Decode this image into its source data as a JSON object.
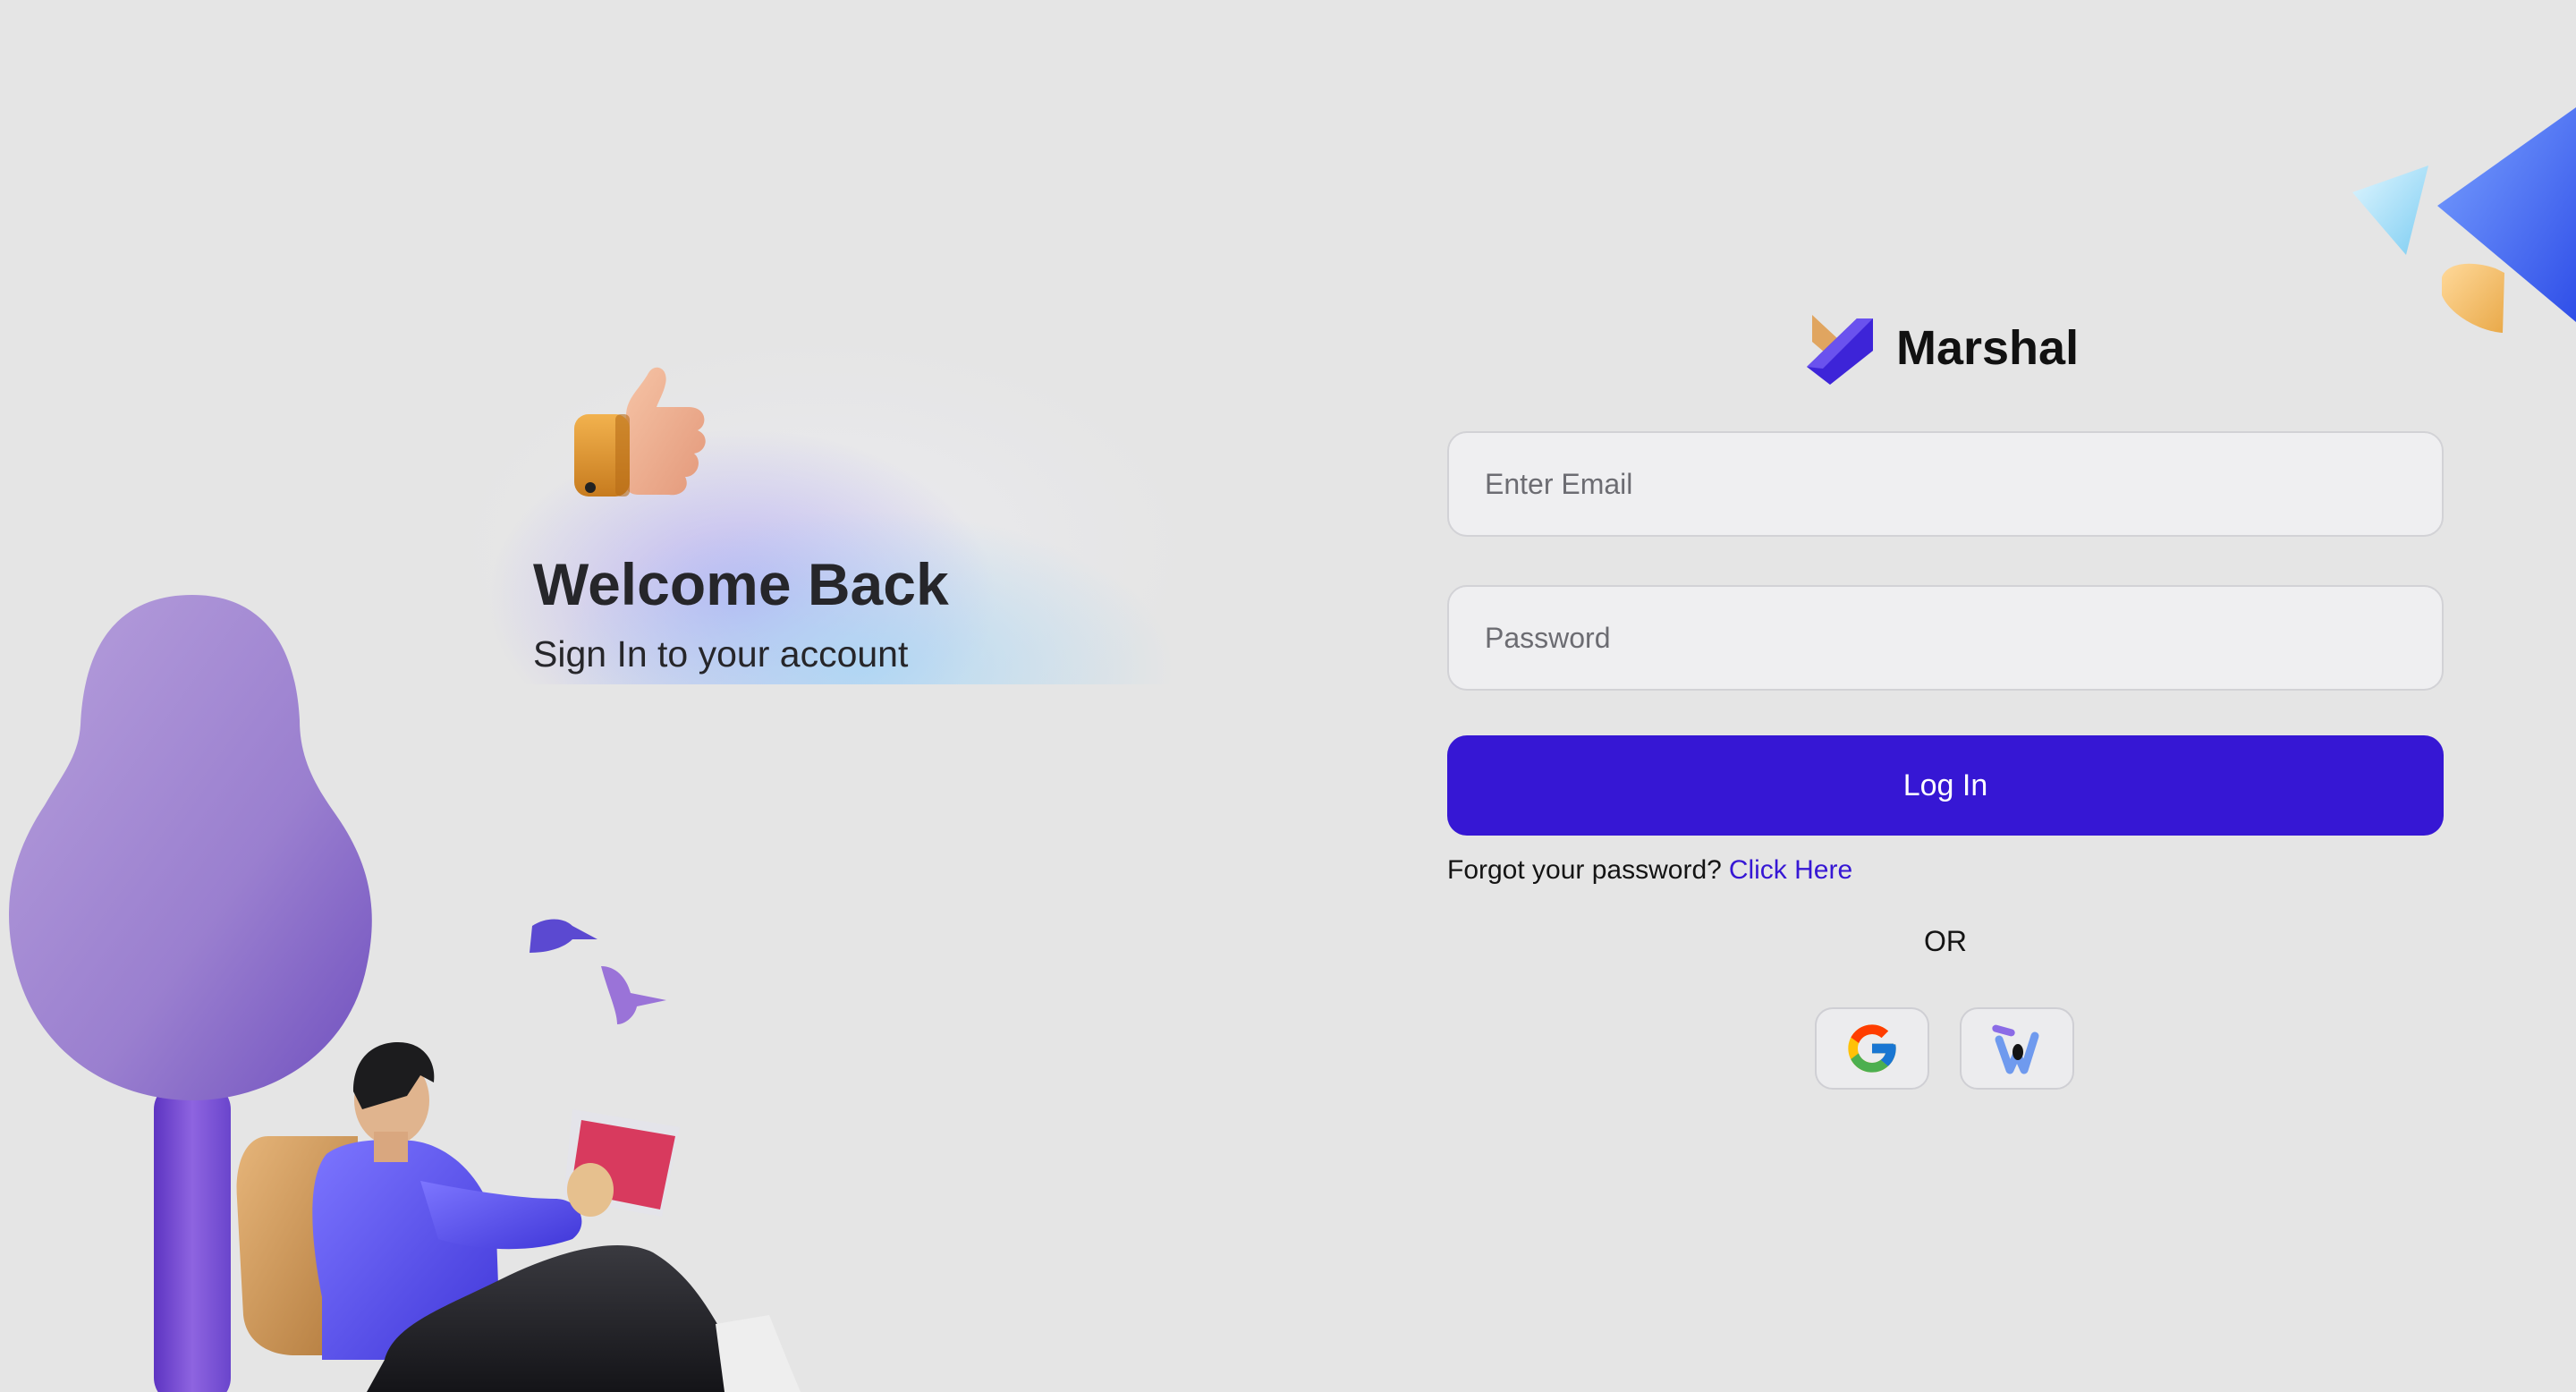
{
  "hero": {
    "title": "Welcome Back",
    "subtitle": "Sign In to your account"
  },
  "brand": {
    "name": "Marshal",
    "logo_icon": "marshal-logo-icon"
  },
  "form": {
    "email_placeholder": "Enter Email",
    "password_placeholder": "Password",
    "login_label": "Log In",
    "forgot_text": "Forgot your password?",
    "forgot_link": "Click Here",
    "or_text": "OR"
  },
  "social": [
    {
      "icon": "google-icon"
    },
    {
      "icon": "w-app-icon"
    }
  ],
  "colors": {
    "background": "#e5e5e5",
    "accent": "#3617d4",
    "text": "#141414"
  }
}
